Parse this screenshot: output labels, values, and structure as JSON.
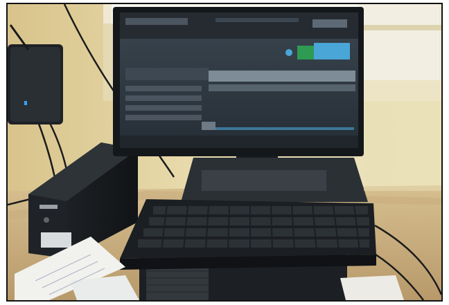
{
  "scene": {
    "subject": "desktop-computer-setup",
    "objects": [
      "wall-router",
      "ups-battery-box",
      "monitor",
      "keyboard",
      "cpu-tower",
      "papers",
      "window",
      "cables"
    ]
  },
  "monitor": {
    "screen_state": "software-running",
    "screen_color": "#2f3942",
    "accent_blue": "#4aa6d6",
    "accent_green": "#2f9a52"
  },
  "colors": {
    "wall": "#e7dcae",
    "window": "#f6f3e6",
    "desk": "#c8b082",
    "device_black": "#1a1d21"
  }
}
